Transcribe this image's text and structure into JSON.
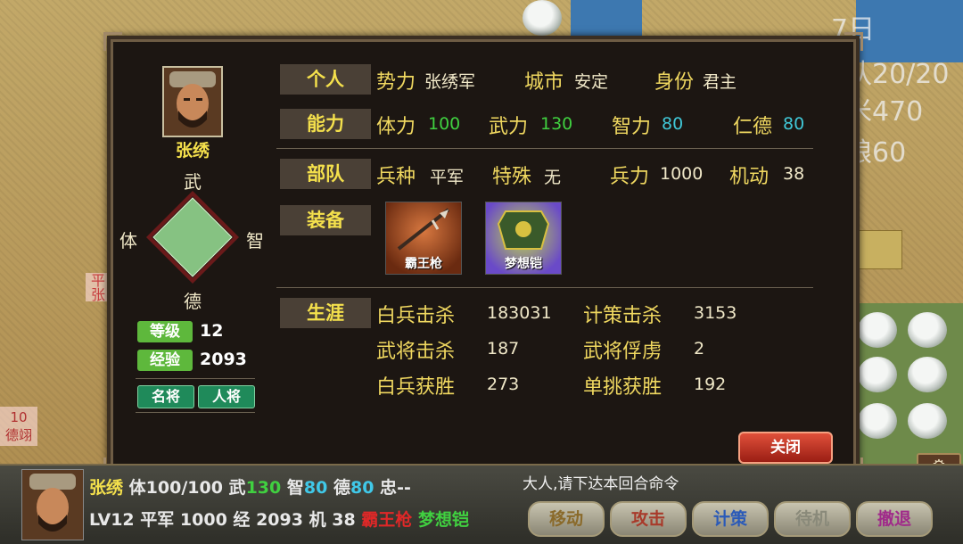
{
  "map": {
    "right_overlay_lines": [
      "7日",
      "队20/20",
      "米470",
      "粮60"
    ],
    "left_tag": "平张",
    "left_tag2_top": "10",
    "left_tag2_bottom": "德翊"
  },
  "general": {
    "name": "张绣",
    "radar_labels": {
      "top": "武",
      "right": "智",
      "bottom": "德",
      "left": "体"
    },
    "level_label": "等级",
    "level": "12",
    "exp_label": "经验",
    "exp": "2093",
    "ranks": [
      "名将",
      "人将"
    ]
  },
  "sections": {
    "personal": {
      "title": "个人",
      "faction_label": "势力",
      "faction": "张绣军",
      "city_label": "城市",
      "city": "安定",
      "identity_label": "身份",
      "identity": "君主"
    },
    "ability": {
      "title": "能力",
      "stamina_label": "体力",
      "stamina": "100",
      "force_label": "武力",
      "force": "130",
      "intellect_label": "智力",
      "intellect": "80",
      "virtue_label": "仁德",
      "virtue": "80"
    },
    "troops": {
      "title": "部队",
      "type_label": "兵种",
      "type": "平军",
      "special_label": "特殊",
      "special": "无",
      "strength_label": "兵力",
      "strength": "1000",
      "mobility_label": "机动",
      "mobility": "38"
    },
    "equipment": {
      "title": "装备",
      "items": [
        {
          "name": "霸王枪",
          "icon": "spear-icon",
          "color": "#c0602a"
        },
        {
          "name": "梦想铠",
          "icon": "armor-icon",
          "color": "#8a6ad0"
        }
      ]
    },
    "career": {
      "title": "生涯",
      "rows": [
        {
          "l1": "白兵击杀",
          "v1": "183031",
          "l2": "计策击杀",
          "v2": "3153"
        },
        {
          "l1": "武将击杀",
          "v1": "187",
          "l2": "武将俘虏",
          "v2": "2"
        },
        {
          "l1": "白兵获胜",
          "v1": "273",
          "l2": "单挑获胜",
          "v2": "192"
        }
      ]
    }
  },
  "close_label": "关闭",
  "bottom_bar": {
    "name": "张绣",
    "stamina_label": "体",
    "stamina": "100/100",
    "force_label": "武",
    "force": "130",
    "intellect_label": "智",
    "intellect": "80",
    "virtue_label": "德",
    "virtue": "80",
    "loyalty_label": "忠",
    "loyalty": "--",
    "lv": "LV12",
    "troop_type": "平军",
    "troops": "1000",
    "exp_label": "经",
    "exp": "2093",
    "mob_label": "机",
    "mob": "38",
    "weapon": "霸王枪",
    "armor": "梦想铠",
    "prompt": "大人,请下达本回合命令",
    "commands": [
      {
        "label": "移动",
        "color": "#8a6a2a"
      },
      {
        "label": "攻击",
        "color": "#a83a2a"
      },
      {
        "label": "计策",
        "color": "#2a5ab8"
      },
      {
        "label": "待机",
        "color": "#8a8a7a"
      },
      {
        "label": "撤退",
        "color": "#a02a8a"
      }
    ]
  }
}
